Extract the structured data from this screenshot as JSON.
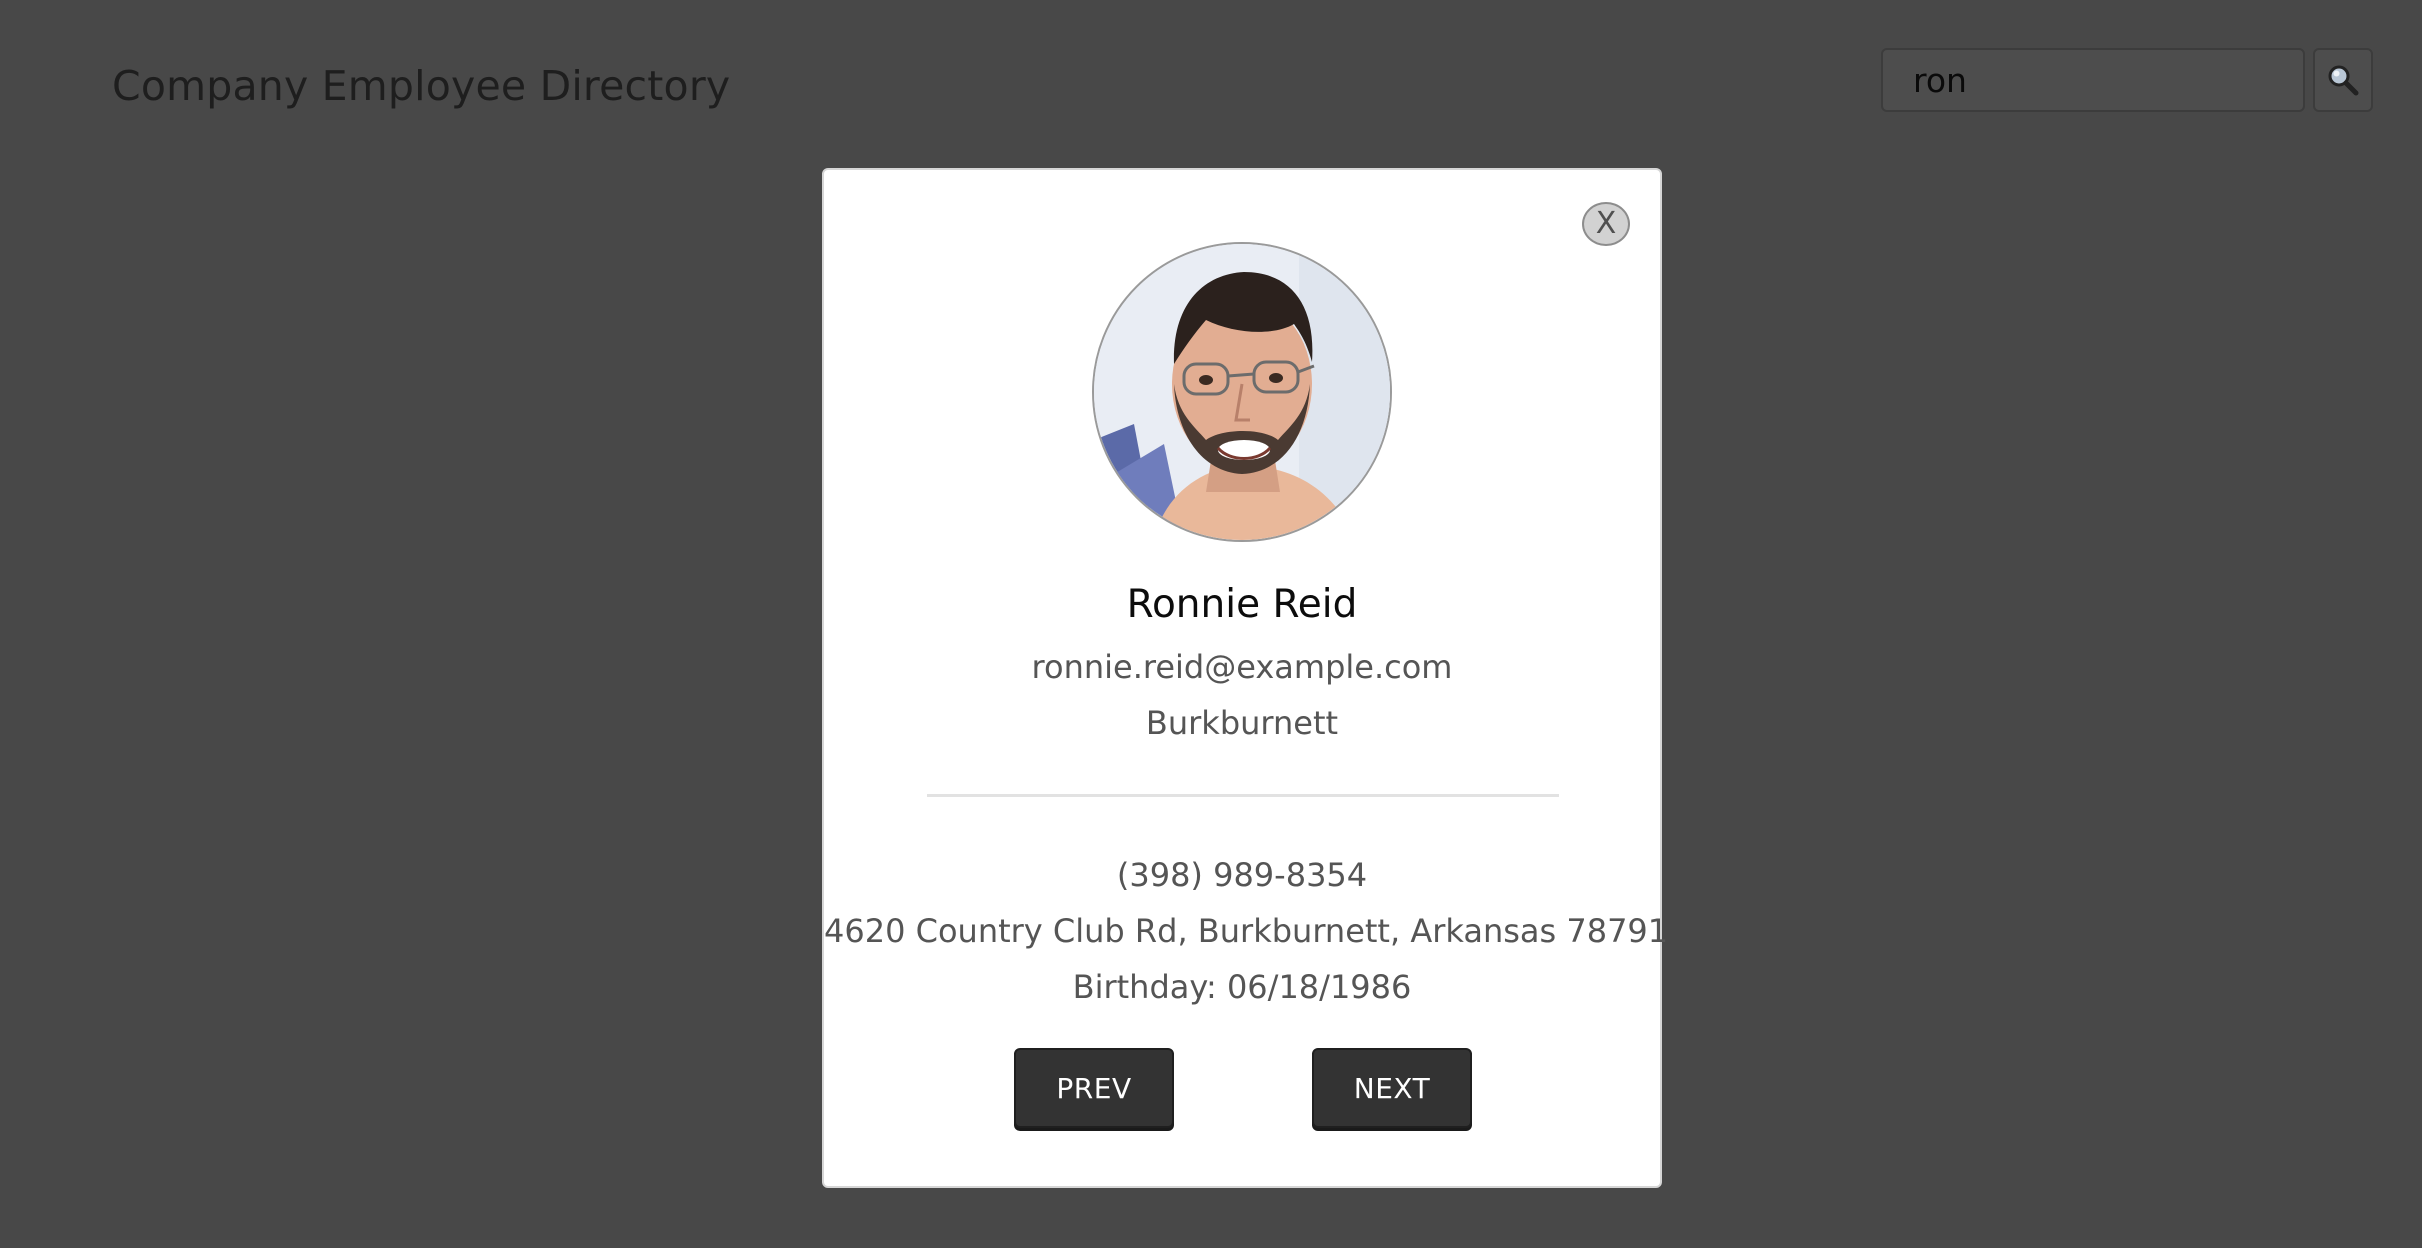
{
  "header": {
    "title": "Company Employee Directory"
  },
  "search": {
    "value": "ron",
    "button_icon": "search-icon"
  },
  "modal": {
    "close_label": "X",
    "avatar_icon": "employee-photo",
    "name": "Ronnie Reid",
    "email": "ronnie.reid@example.com",
    "city": "Burkburnett",
    "phone": "(398) 989-8354",
    "address": "4620 Country Club Rd, Burkburnett, Arkansas 78791",
    "birthday": "Birthday: 06/18/1986",
    "prev_label": "PREV",
    "next_label": "NEXT"
  },
  "colors": {
    "page_background": "#484848",
    "modal_background": "#ffffff",
    "button_background": "#333333",
    "secondary_text": "#555555"
  }
}
